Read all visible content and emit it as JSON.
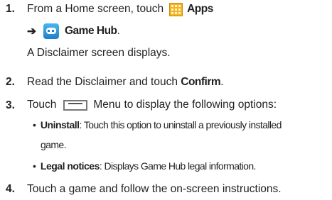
{
  "steps": [
    {
      "number": "1.",
      "part1": "From a Home screen, touch",
      "icon1": "apps-grid-icon",
      "bold1": "Apps",
      "arrow": "➔",
      "icon2": "game-controller-icon",
      "bold2": "Game Hub",
      "tail2": ".",
      "note": "A Disclaimer screen displays."
    },
    {
      "number": "2.",
      "text": "Read the Disclaimer and touch ",
      "bold": "Confirm",
      "tail": "."
    },
    {
      "number": "3.",
      "part1": "Touch",
      "icon": "menu-key-icon",
      "part2": "Menu to display the following options:",
      "bullets": [
        {
          "marker": "•",
          "bold": "Uninstall",
          "text": ": Touch this option to uninstall a previously installed",
          "cont": "game."
        },
        {
          "marker": "•",
          "bold": "Legal notices",
          "text": ": Displays Game Hub legal information."
        }
      ]
    },
    {
      "number": "4.",
      "text": "Touch a game and follow the on-screen instructions."
    }
  ]
}
